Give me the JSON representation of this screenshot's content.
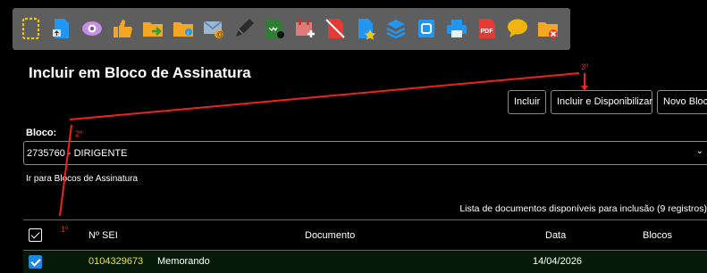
{
  "toolbar": {
    "icons": [
      "document-dashed-icon",
      "document-upload-icon",
      "eye-icon",
      "thumbs-up-icon",
      "folder-arrow-icon",
      "folder-user-icon",
      "email-at-icon",
      "pen-icon",
      "document-sign-icon",
      "calendar-add-icon",
      "document-cancel-icon",
      "document-star-icon",
      "layers-icon",
      "document-copy-icon",
      "printer-icon",
      "pdf-icon",
      "speech-bubble-icon",
      "folder-delete-icon"
    ]
  },
  "page": {
    "title": "Incluir em Bloco de Assinatura"
  },
  "buttons": {
    "incluir": "Incluir",
    "incluir_disponibilizar": "Incluir e Disponibilizar",
    "novo_bloco": "Novo Bloco"
  },
  "bloco": {
    "label": "Bloco:",
    "selected": "2735760 - DIRIGENTE",
    "chevron": "⌄"
  },
  "ir_link": "Ir para Blocos de Assinatura",
  "table": {
    "caption": "Lista de documentos disponíveis para inclusão (9 registros)",
    "headers": {
      "sei": "Nº SEI",
      "documento": "Documento",
      "data": "Data",
      "blocos": "Blocos"
    },
    "rows": [
      {
        "sei": "0104329673",
        "documento": "Memorando",
        "data": "14/04/2026",
        "blocos": ""
      }
    ]
  },
  "annotations": {
    "step1": "1º",
    "step2": "2º",
    "step3": "3º"
  },
  "colors": {
    "toolbar_bg": "#5e5e5e",
    "accent_yellow": "#e8e23a",
    "checkbox_blue": "#1e88e5",
    "annotation_red": "#e23",
    "selected_row_bg": "#071a07"
  }
}
